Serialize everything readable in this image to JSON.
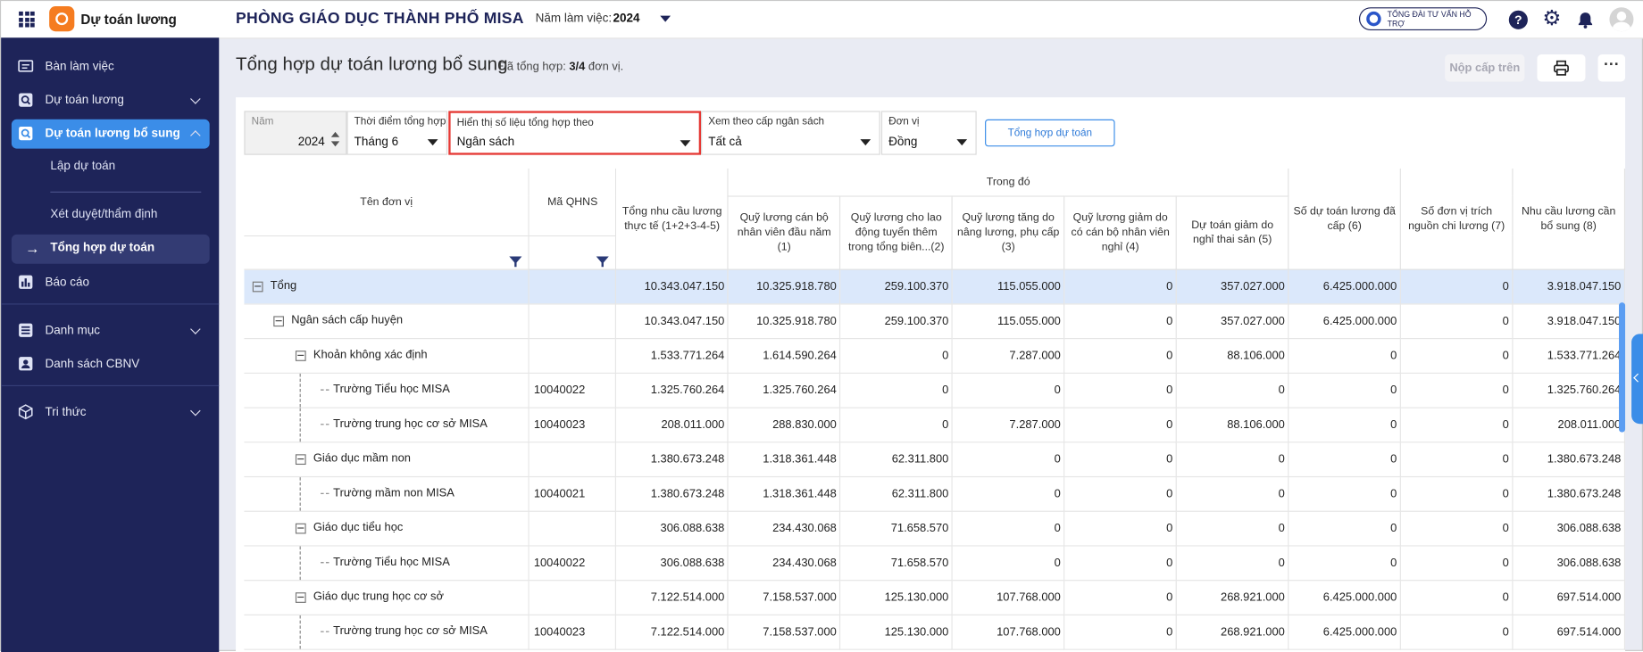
{
  "app": {
    "name": "Dự toán lương",
    "org": "PHÒNG GIÁO DỤC THÀNH PHỐ MISA",
    "year_label": "Năm làm việc:",
    "year_value": "2024",
    "hotline": "TỔNG ĐÀI TƯ VẤN HỖ TRỢ",
    "accent": "#3b8de8",
    "sidebar_bg": "#1e2459"
  },
  "topbar_icons": [
    "help-icon",
    "gear-icon",
    "bell-icon",
    "avatar"
  ],
  "sidebar": {
    "items": [
      {
        "label": "Bàn làm việc",
        "icon": "desk-icon"
      },
      {
        "label": "Dự toán lương",
        "icon": "search-doc-icon"
      },
      {
        "label": "Dự toán lương bổ sung",
        "icon": "search-doc-icon"
      },
      {
        "label": "Báo cáo",
        "icon": "chart-icon"
      },
      {
        "label": "Danh mục",
        "icon": "list-icon"
      },
      {
        "label": "Danh sách CBNV",
        "icon": "id-card-icon"
      },
      {
        "label": "Tri thức",
        "icon": "cube-icon"
      }
    ],
    "subitems": [
      {
        "label": "Lập dự toán"
      },
      {
        "label": "Xét duyệt/thẩm định"
      },
      {
        "label": "Tổng hợp dự toán"
      }
    ]
  },
  "page": {
    "title": "Tổng hợp dự toán lương bổ sung",
    "summary_prefix": "Đã tổng hợp:",
    "summary_count": "3/4",
    "summary_suffix": "đơn vị.",
    "submit_label": "Nộp cấp trên",
    "more_label": "···"
  },
  "filters": {
    "year": {
      "label": "Năm",
      "value": "2024"
    },
    "time": {
      "label": "Thời điểm tổng hợp",
      "value": "Tháng 6"
    },
    "display": {
      "label": "Hiển thị số liệu tổng hợp theo",
      "value": "Ngân sách"
    },
    "level": {
      "label": "Xem theo cấp ngân sách",
      "value": "Tất cả"
    },
    "unit": {
      "label": "Đơn vị",
      "value": "Đồng"
    },
    "button": "Tổng hợp dự toán"
  },
  "table": {
    "headers": {
      "name": "Tên đơn vị",
      "code": "Mã QHNS",
      "total": "Tổng nhu cầu lương thực tế (1+2+3-4-5)",
      "group": "Trong đó",
      "c1": "Quỹ lương cán bộ nhân viên đầu năm (1)",
      "c2": "Quỹ lương cho lao động tuyển thêm trong tổng biên...(2)",
      "c3": "Quỹ lương tăng do nâng lương, phụ cấp (3)",
      "c4": "Quỹ lương giảm do có cán bộ nhân viên nghỉ (4)",
      "c5": "Dự toán giảm do nghỉ thai sản (5)",
      "c6": "Số dự toán lương đã cấp (6)",
      "c7": "Số đơn vị trích nguồn chi lương (7)",
      "c8": "Nhu cầu lương cần bổ sung (8)"
    },
    "rows": [
      {
        "name": "Tổng",
        "code": "",
        "total": "10.343.047.150",
        "c1": "10.325.918.780",
        "c2": "259.100.370",
        "c3": "115.055.000",
        "c4": "0",
        "c5": "357.027.000",
        "c6": "6.425.000.000",
        "c7": "0",
        "c8": "3.918.047.150"
      },
      {
        "name": "Ngân sách cấp huyện",
        "code": "",
        "total": "10.343.047.150",
        "c1": "10.325.918.780",
        "c2": "259.100.370",
        "c3": "115.055.000",
        "c4": "0",
        "c5": "357.027.000",
        "c6": "6.425.000.000",
        "c7": "0",
        "c8": "3.918.047.150"
      },
      {
        "name": "Khoản không xác định",
        "code": "",
        "total": "1.533.771.264",
        "c1": "1.614.590.264",
        "c2": "0",
        "c3": "7.287.000",
        "c4": "0",
        "c5": "88.106.000",
        "c6": "0",
        "c7": "0",
        "c8": "1.533.771.264"
      },
      {
        "name": "Trường Tiểu học MISA",
        "code": "10040022",
        "total": "1.325.760.264",
        "c1": "1.325.760.264",
        "c2": "0",
        "c3": "0",
        "c4": "0",
        "c5": "0",
        "c6": "0",
        "c7": "0",
        "c8": "1.325.760.264"
      },
      {
        "name": "Trường trung học cơ sở MISA",
        "code": "10040023",
        "total": "208.011.000",
        "c1": "288.830.000",
        "c2": "0",
        "c3": "7.287.000",
        "c4": "0",
        "c5": "88.106.000",
        "c6": "0",
        "c7": "0",
        "c8": "208.011.000"
      },
      {
        "name": "Giáo dục mầm non",
        "code": "",
        "total": "1.380.673.248",
        "c1": "1.318.361.448",
        "c2": "62.311.800",
        "c3": "0",
        "c4": "0",
        "c5": "0",
        "c6": "0",
        "c7": "0",
        "c8": "1.380.673.248"
      },
      {
        "name": "Trường mầm non MISA",
        "code": "10040021",
        "total": "1.380.673.248",
        "c1": "1.318.361.448",
        "c2": "62.311.800",
        "c3": "0",
        "c4": "0",
        "c5": "0",
        "c6": "0",
        "c7": "0",
        "c8": "1.380.673.248"
      },
      {
        "name": "Giáo dục tiểu học",
        "code": "",
        "total": "306.088.638",
        "c1": "234.430.068",
        "c2": "71.658.570",
        "c3": "0",
        "c4": "0",
        "c5": "0",
        "c6": "0",
        "c7": "0",
        "c8": "306.088.638"
      },
      {
        "name": "Trường Tiểu học MISA",
        "code": "10040022",
        "total": "306.088.638",
        "c1": "234.430.068",
        "c2": "71.658.570",
        "c3": "0",
        "c4": "0",
        "c5": "0",
        "c6": "0",
        "c7": "0",
        "c8": "306.088.638"
      },
      {
        "name": "Giáo dục trung học cơ sở",
        "code": "",
        "total": "7.122.514.000",
        "c1": "7.158.537.000",
        "c2": "125.130.000",
        "c3": "107.768.000",
        "c4": "0",
        "c5": "268.921.000",
        "c6": "6.425.000.000",
        "c7": "0",
        "c8": "697.514.000"
      },
      {
        "name": "Trường trung học cơ sở MISA",
        "code": "10040023",
        "total": "7.122.514.000",
        "c1": "7.158.537.000",
        "c2": "125.130.000",
        "c3": "107.768.000",
        "c4": "0",
        "c5": "268.921.000",
        "c6": "6.425.000.000",
        "c7": "0",
        "c8": "697.514.000"
      }
    ]
  }
}
